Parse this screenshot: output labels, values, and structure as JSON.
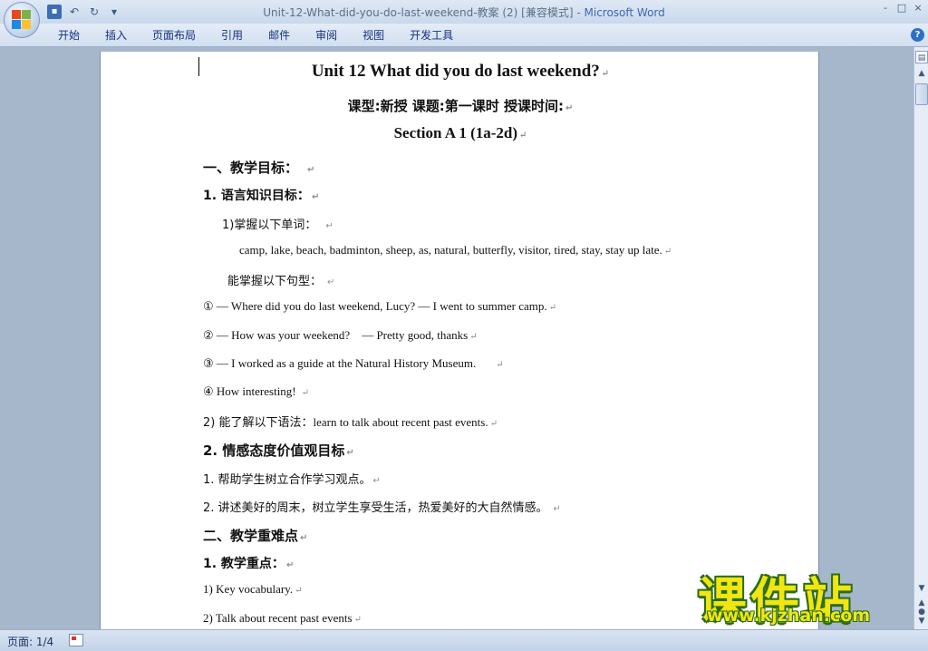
{
  "window": {
    "title_doc": "Unit-12-What-did-you-do-last-weekend-教案 (2) [兼容模式] - ",
    "title_app": "Microsoft Word",
    "controls": [
      "-",
      "□",
      "×"
    ]
  },
  "ribbon": {
    "tabs": [
      "开始",
      "插入",
      "页面布局",
      "引用",
      "邮件",
      "审阅",
      "视图",
      "开发工具"
    ],
    "help": "?"
  },
  "document": {
    "title": "Unit 12 What did you do last weekend?",
    "subtitle": "课型:新授  课题:第一课时  授课时间:",
    "section": "Section A 1 (1a-2d)",
    "heading1": "一、教学目标：",
    "h1_1": "1. 语言知识目标：",
    "item_words_label": "1)掌握以下单词：",
    "words": "camp, lake, beach, badminton, sheep, as, natural, butterfly, visitor, tired, stay, stay up late.",
    "sentences_label": "能掌握以下句型：",
    "s1": "① — Where did you do last weekend, Lucy? — I went to summer camp.",
    "s2": "② — How was your weekend?    — Pretty good, thanks",
    "s3": "③ — I worked as a guide at the Natural History Museum.",
    "s4": "④ How interesting!",
    "grammar_prefix": "2)  能了解以下语法：",
    "grammar_text": "learn to talk about recent past events.",
    "h1_2": "2. 情感态度价值观目标",
    "e1": "1. 帮助学生树立合作学习观点。",
    "e2": "2. 讲述美好的周末，树立学生享受生活，热爱美好的大自然情感。",
    "heading2": "二、教学重难点",
    "h2_1": "1. 教学重点：",
    "k1": "1) Key vocabulary.",
    "k2": "2) Talk about recent past events",
    "para_mark": "↵"
  },
  "status": {
    "page": "页面: 1/4"
  },
  "watermark": {
    "main": "课件站",
    "url": "www.kjzhan.com"
  }
}
